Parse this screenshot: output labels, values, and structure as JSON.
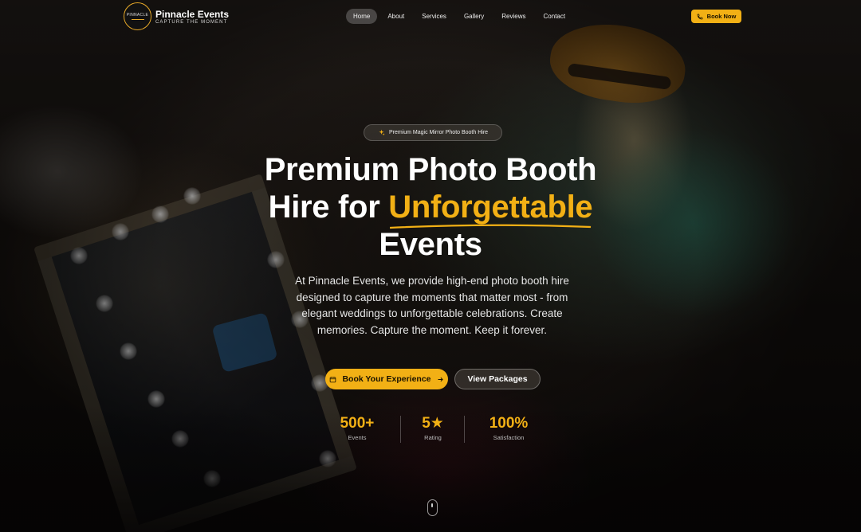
{
  "brand": {
    "name": "Pinnacle Events",
    "tagline": "CAPTURE THE MOMENT",
    "badge_text": "PINNACLE"
  },
  "nav": {
    "items": [
      {
        "label": "Home",
        "active": true
      },
      {
        "label": "About",
        "active": false
      },
      {
        "label": "Services",
        "active": false
      },
      {
        "label": "Gallery",
        "active": false
      },
      {
        "label": "Reviews",
        "active": false
      },
      {
        "label": "Contact",
        "active": false
      }
    ],
    "cta_label": "Book Now",
    "cta_icon": "phone-icon"
  },
  "hero": {
    "pill_label": "Premium Magic Mirror Photo Booth Hire",
    "pill_icon": "sparkles-icon",
    "headline_part1": "Premium Photo Booth Hire for ",
    "headline_accent": "Unforgettable",
    "headline_part2": "Events",
    "lead": "At Pinnacle Events, we provide high-end photo booth hire designed to capture the moments that matter most - from elegant weddings to unforgettable celebrations. Create memories. Capture the moment. Keep it forever.",
    "primary_cta": "Book Your Experience",
    "secondary_cta": "View Packages",
    "stats": [
      {
        "value": "500+",
        "label": "Events"
      },
      {
        "value": "5★",
        "label": "Rating"
      },
      {
        "value": "100%",
        "label": "Satisfaction"
      }
    ]
  },
  "colors": {
    "accent": "#f2b015",
    "background": "#0a0807"
  }
}
